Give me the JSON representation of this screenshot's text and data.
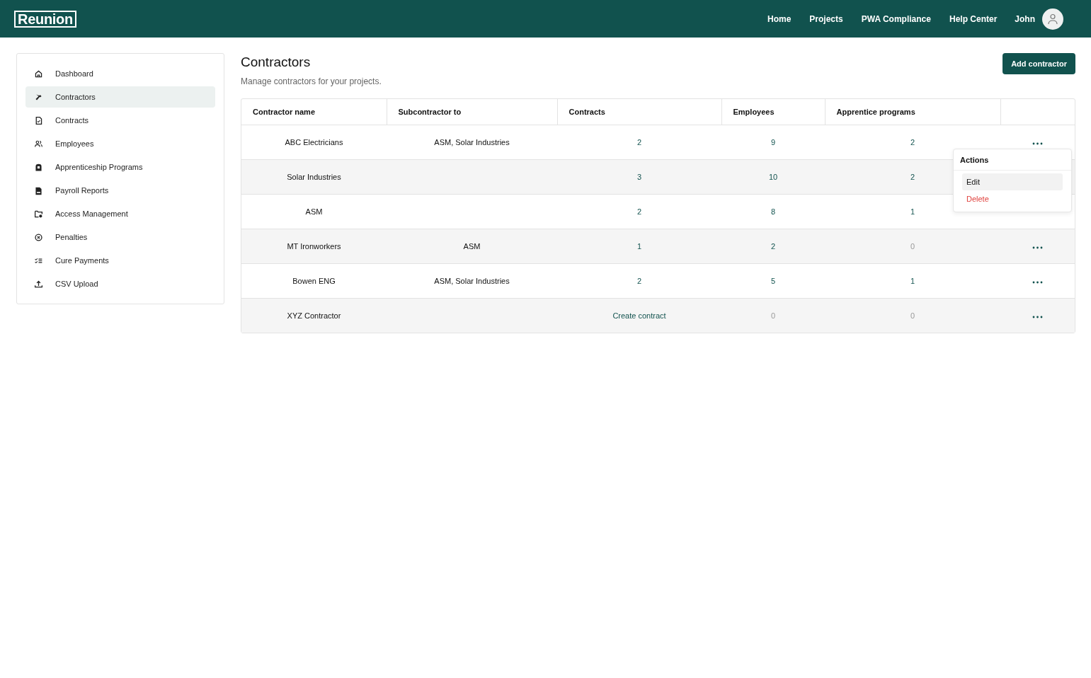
{
  "header": {
    "logo": "Reunion",
    "nav": [
      "Home",
      "Projects",
      "PWA Compliance",
      "Help Center"
    ],
    "user": "John"
  },
  "sidebar": {
    "items": [
      {
        "label": "Dashboard",
        "selected": false
      },
      {
        "label": "Contractors",
        "selected": true
      },
      {
        "label": "Contracts",
        "selected": false
      },
      {
        "label": "Employees",
        "selected": false
      },
      {
        "label": "Apprenticeship Programs",
        "selected": false
      },
      {
        "label": "Payroll Reports",
        "selected": false
      },
      {
        "label": "Access Management",
        "selected": false
      },
      {
        "label": "Penalties",
        "selected": false
      },
      {
        "label": "Cure Payments",
        "selected": false
      },
      {
        "label": "CSV Upload",
        "selected": false
      }
    ]
  },
  "page": {
    "title": "Contractors",
    "subtitle": "Manage contractors for your projects.",
    "add_button": "Add contractor"
  },
  "table": {
    "columns": [
      "Contractor name",
      "Subcontractor to",
      "Contracts",
      "Employees",
      "Apprentice programs"
    ],
    "rows": [
      {
        "cells": [
          {
            "text": "ABC Electricians",
            "kind": "plain"
          },
          {
            "text": "ASM, Solar Industries",
            "kind": "plain"
          },
          {
            "text": "2",
            "kind": "link"
          },
          {
            "text": "9",
            "kind": "link"
          },
          {
            "text": "2",
            "kind": "link"
          }
        ],
        "actions_visible": true
      },
      {
        "cells": [
          {
            "text": "Solar Industries",
            "kind": "plain"
          },
          null,
          {
            "text": "3",
            "kind": "link"
          },
          {
            "text": "10",
            "kind": "link"
          },
          {
            "text": "2",
            "kind": "link"
          }
        ],
        "actions_visible": false
      },
      {
        "cells": [
          {
            "text": "ASM",
            "kind": "plain"
          },
          null,
          {
            "text": "2",
            "kind": "link"
          },
          {
            "text": "8",
            "kind": "link"
          },
          {
            "text": "1",
            "kind": "link"
          }
        ],
        "actions_visible": false
      },
      {
        "cells": [
          {
            "text": "MT Ironworkers",
            "kind": "plain"
          },
          {
            "text": "ASM",
            "kind": "plain"
          },
          {
            "text": "1",
            "kind": "link"
          },
          {
            "text": "2",
            "kind": "link"
          },
          {
            "text": "0",
            "kind": "muted"
          }
        ],
        "actions_visible": true
      },
      {
        "cells": [
          {
            "text": "Bowen ENG",
            "kind": "plain"
          },
          {
            "text": "ASM, Solar Industries",
            "kind": "plain"
          },
          {
            "text": "2",
            "kind": "link"
          },
          {
            "text": "5",
            "kind": "link"
          },
          {
            "text": "1",
            "kind": "link"
          }
        ],
        "actions_visible": true
      },
      {
        "cells": [
          {
            "text": "XYZ Contractor",
            "kind": "plain"
          },
          null,
          {
            "text": "Create contract",
            "kind": "link"
          },
          {
            "text": "0",
            "kind": "muted"
          },
          {
            "text": "0",
            "kind": "muted"
          }
        ],
        "actions_visible": true
      }
    ]
  },
  "actions_menu": {
    "title": "Actions",
    "items": [
      {
        "label": "Edit",
        "kind": "normal",
        "selected": true
      },
      {
        "label": "Delete",
        "kind": "danger",
        "selected": false
      }
    ]
  }
}
